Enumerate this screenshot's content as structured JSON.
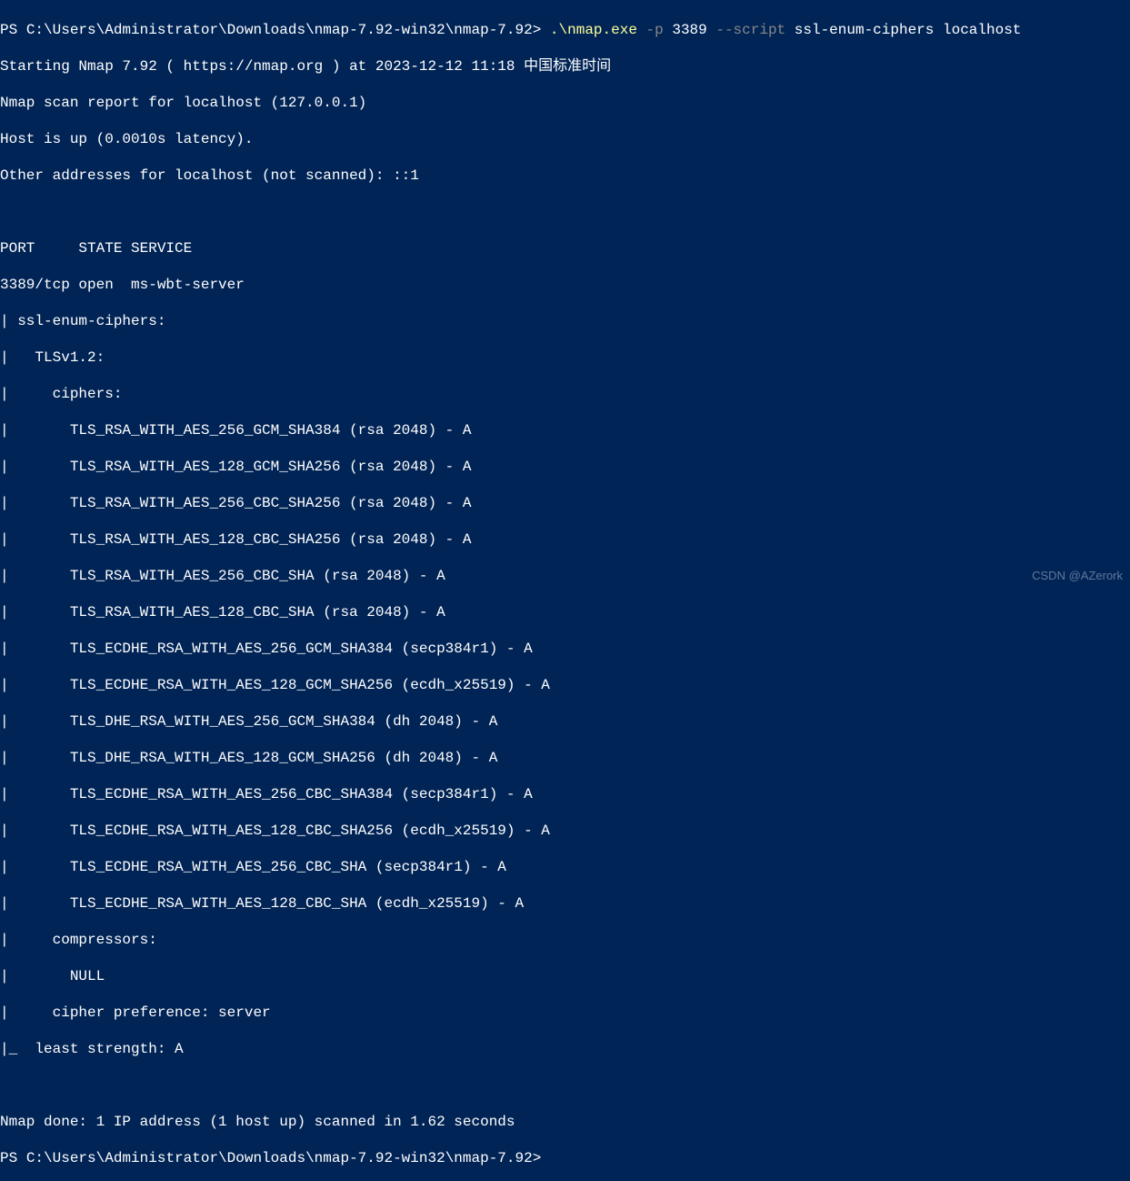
{
  "prompt": {
    "prefix": "PS ",
    "path": "C:\\Users\\Administrator\\Downloads\\nmap-7.92-win32\\nmap-7.92",
    "suffix": "> "
  },
  "command": {
    "executable": ".\\nmap.exe",
    "flag_p": " -p",
    "port": " 3389 ",
    "flag_script": "--script",
    "script_args": " ssl-enum-ciphers localhost"
  },
  "output": {
    "line1": "Starting Nmap 7.92 ( https://nmap.org ) at 2023-12-12 11:18 中国标准时间",
    "line2": "Nmap scan report for localhost (127.0.0.1)",
    "line3": "Host is up (0.0010s latency).",
    "line4": "Other addresses for localhost (not scanned): ::1",
    "line5": "",
    "line6": "PORT     STATE SERVICE",
    "line7": "3389/tcp open  ms-wbt-server",
    "line8": "| ssl-enum-ciphers: ",
    "line9": "|   TLSv1.2: ",
    "line10": "|     ciphers: ",
    "line11": "|       TLS_RSA_WITH_AES_256_GCM_SHA384 (rsa 2048) - A",
    "line12": "|       TLS_RSA_WITH_AES_128_GCM_SHA256 (rsa 2048) - A",
    "line13": "|       TLS_RSA_WITH_AES_256_CBC_SHA256 (rsa 2048) - A",
    "line14": "|       TLS_RSA_WITH_AES_128_CBC_SHA256 (rsa 2048) - A",
    "line15": "|       TLS_RSA_WITH_AES_256_CBC_SHA (rsa 2048) - A",
    "line16": "|       TLS_RSA_WITH_AES_128_CBC_SHA (rsa 2048) - A",
    "line17": "|       TLS_ECDHE_RSA_WITH_AES_256_GCM_SHA384 (secp384r1) - A",
    "line18": "|       TLS_ECDHE_RSA_WITH_AES_128_GCM_SHA256 (ecdh_x25519) - A",
    "line19": "|       TLS_DHE_RSA_WITH_AES_256_GCM_SHA384 (dh 2048) - A",
    "line20": "|       TLS_DHE_RSA_WITH_AES_128_GCM_SHA256 (dh 2048) - A",
    "line21": "|       TLS_ECDHE_RSA_WITH_AES_256_CBC_SHA384 (secp384r1) - A",
    "line22": "|       TLS_ECDHE_RSA_WITH_AES_128_CBC_SHA256 (ecdh_x25519) - A",
    "line23": "|       TLS_ECDHE_RSA_WITH_AES_256_CBC_SHA (secp384r1) - A",
    "line24": "|       TLS_ECDHE_RSA_WITH_AES_128_CBC_SHA (ecdh_x25519) - A",
    "line25": "|     compressors: ",
    "line26": "|       NULL",
    "line27": "|     cipher preference: server",
    "line28": "|_  least strength: A",
    "line29": "",
    "line30": "Nmap done: 1 IP address (1 host up) scanned in 1.62 seconds"
  },
  "watermark": "CSDN @AZerork"
}
